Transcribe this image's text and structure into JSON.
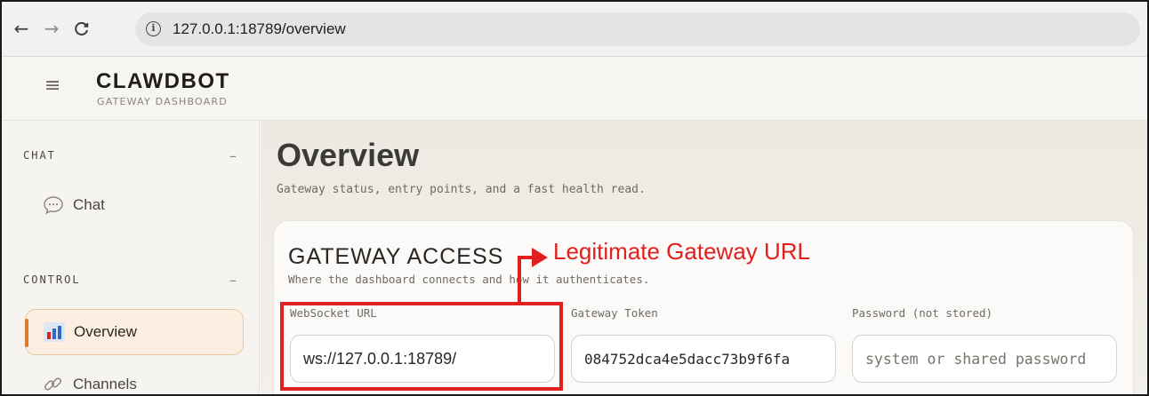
{
  "browser": {
    "back_icon": "←",
    "forward_icon": "→",
    "reload_icon": "C",
    "info_icon": "i",
    "url": "127.0.0.1:18789/overview"
  },
  "header": {
    "menu_icon": "≡",
    "brand_title": "CLAWDBOT",
    "brand_subtitle": "GATEWAY DASHBOARD"
  },
  "sidebar": {
    "sections": [
      {
        "label": "CHAT",
        "toggle": "–"
      },
      {
        "label": "CONTROL",
        "toggle": "–"
      }
    ],
    "items": [
      {
        "label": "Chat",
        "icon": "chat-bubble-icon"
      },
      {
        "label": "Overview",
        "icon": "bar-chart-icon",
        "active": true
      },
      {
        "label": "Channels",
        "icon": "link-icon"
      }
    ]
  },
  "main": {
    "title": "Overview",
    "subtitle": "Gateway status, entry points, and a fast health read.",
    "card": {
      "title": "GATEWAY ACCESS",
      "subtitle": "Where the dashboard connects and how it authenticates.",
      "fields": [
        {
          "label": "WebSocket URL",
          "value": "ws://127.0.0.1:18789/",
          "placeholder": ""
        },
        {
          "label": "Gateway Token",
          "value": "084752dca4e5dacc73b9f6fa",
          "placeholder": ""
        },
        {
          "label": "Password (not stored)",
          "value": "",
          "placeholder": "system or shared password"
        }
      ]
    }
  },
  "annotation": {
    "label": "Legitimate Gateway URL",
    "color": "#e0201e"
  },
  "colors": {
    "accent": "#e07a2c",
    "active_bg": "#fcefe1"
  }
}
